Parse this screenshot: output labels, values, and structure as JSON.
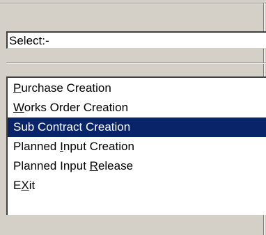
{
  "combo": {
    "value": "Select:-"
  },
  "menu": {
    "items": [
      {
        "label": "Purchase Creation",
        "mnemonic_index": 0,
        "selected": false
      },
      {
        "label": "Works Order Creation",
        "mnemonic_index": 0,
        "selected": false
      },
      {
        "label": "Sub Contract Creation",
        "mnemonic_index": -1,
        "selected": true
      },
      {
        "label": "Planned Input Creation",
        "mnemonic_index": 8,
        "selected": false
      },
      {
        "label": "Planned Input Release",
        "mnemonic_index": 14,
        "selected": false
      },
      {
        "label": "EXit",
        "mnemonic_index": 1,
        "selected": false
      }
    ]
  },
  "colors": {
    "selection_background": "#0a246a",
    "selection_text": "#ffffff",
    "dialog_background": "#d4d0c8"
  }
}
